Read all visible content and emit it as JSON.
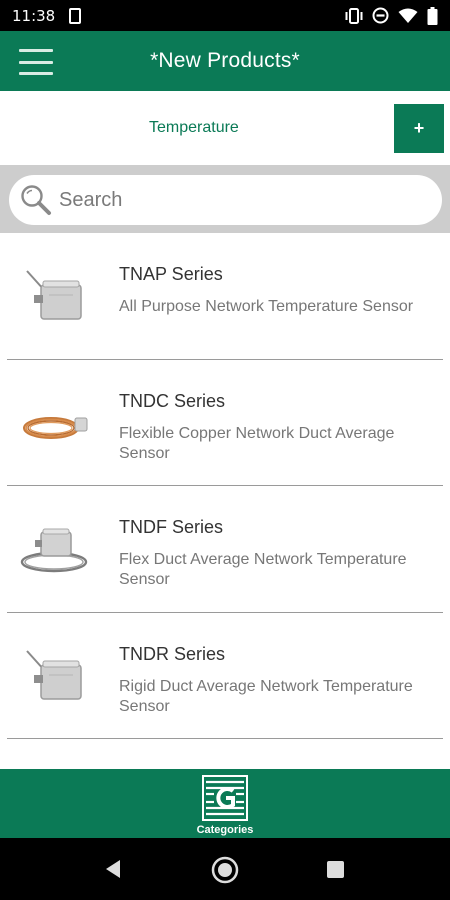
{
  "status_bar": {
    "time": "11:38",
    "icons": [
      "notification-icon",
      "vibrate-icon",
      "do-not-disturb-icon",
      "wifi-icon",
      "battery-icon"
    ]
  },
  "app_bar": {
    "title": "*New Products*",
    "menu_icon": "hamburger-menu-icon"
  },
  "category": {
    "label": "Temperature",
    "add_label": "+"
  },
  "search": {
    "placeholder": "Search",
    "icon": "search-icon"
  },
  "products": [
    {
      "name": "TNAP Series",
      "description": "All Purpose Network Temperature Sensor",
      "thumb": "enclosure-probe"
    },
    {
      "name": "TNDC Series",
      "description": "Flexible Copper Network Duct Average Sensor",
      "thumb": "copper-coil"
    },
    {
      "name": "TNDF Series",
      "description": "Flex Duct Average Network Temperature Sensor",
      "thumb": "flex-cable"
    },
    {
      "name": "TNDR Series",
      "description": "Rigid Duct Average Network Temperature Sensor",
      "thumb": "enclosure-probe"
    }
  ],
  "bottom_nav": {
    "categories_label": "Categories",
    "categories_icon": "company-logo-icon"
  },
  "colors": {
    "primary": "#0b7a56",
    "search_band": "#cdcdcd",
    "divider": "#9a9a9a"
  }
}
